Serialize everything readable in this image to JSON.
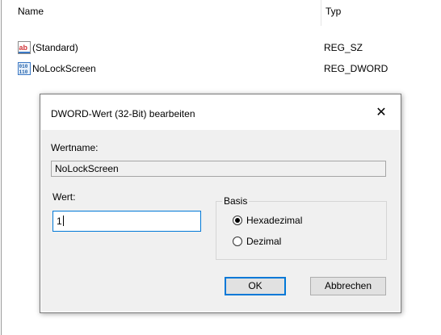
{
  "list": {
    "columns": {
      "name": "Name",
      "type": "Typ"
    },
    "rows": [
      {
        "name": "(Standard)",
        "type": "REG_SZ",
        "icon": "string-value-icon"
      },
      {
        "name": "NoLockScreen",
        "type": "REG_DWORD",
        "icon": "binary-value-icon"
      }
    ]
  },
  "dialog": {
    "title": "DWORD-Wert (32-Bit) bearbeiten",
    "close_glyph": "✕",
    "value_name_label": "Wertname:",
    "value_name": "NoLockScreen",
    "value_label": "Wert:",
    "value": "1",
    "base_label": "Basis",
    "radio_hex": "Hexadezimal",
    "radio_dec": "Dezimal",
    "selected_base": "Hexadezimal",
    "ok_label": "OK",
    "cancel_label": "Abbrechen"
  },
  "colors": {
    "accent": "#0078d7",
    "dialog_background": "#f0f0f0",
    "button_background": "#e1e1e1"
  }
}
